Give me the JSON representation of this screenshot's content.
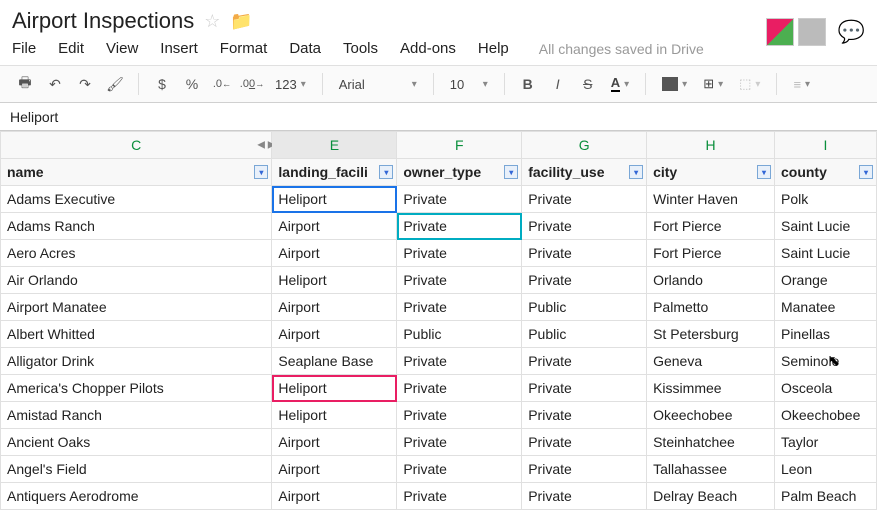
{
  "doc_title": "Airport Inspections",
  "menu": [
    "File",
    "Edit",
    "View",
    "Insert",
    "Format",
    "Data",
    "Tools",
    "Add-ons",
    "Help"
  ],
  "save_status": "All changes saved in Drive",
  "toolbar": {
    "currency": "$",
    "percent": "%",
    "dec_dec": ".0←",
    "dec_inc": ".00→",
    "num_format": "123",
    "font": "Arial",
    "font_size": "10"
  },
  "formula_bar": "Heliport",
  "columns": [
    {
      "letter": "C",
      "header": "name",
      "w": "w-name"
    },
    {
      "letter": "E",
      "header": "landing_facili",
      "w": "w-lf",
      "selected": true
    },
    {
      "letter": "F",
      "header": "owner_type",
      "w": "w-ot"
    },
    {
      "letter": "G",
      "header": "facility_use",
      "w": "w-fu"
    },
    {
      "letter": "H",
      "header": "city",
      "w": "w-city"
    },
    {
      "letter": "I",
      "header": "county",
      "w": "w-county"
    }
  ],
  "rows": [
    {
      "name": "Adams Executive",
      "lf": "Heliport",
      "ot": "Private",
      "fu": "Private",
      "city": "Winter Haven",
      "county": "Polk"
    },
    {
      "name": "Adams Ranch",
      "lf": "Airport",
      "ot": "Private",
      "fu": "Private",
      "city": "Fort Pierce",
      "county": "Saint Lucie"
    },
    {
      "name": "Aero Acres",
      "lf": "Airport",
      "ot": "Private",
      "fu": "Private",
      "city": "Fort Pierce",
      "county": "Saint Lucie"
    },
    {
      "name": "Air Orlando",
      "lf": "Heliport",
      "ot": "Private",
      "fu": "Private",
      "city": "Orlando",
      "county": "Orange"
    },
    {
      "name": "Airport Manatee",
      "lf": "Airport",
      "ot": "Private",
      "fu": "Public",
      "city": "Palmetto",
      "county": "Manatee"
    },
    {
      "name": "Albert Whitted",
      "lf": "Airport",
      "ot": "Public",
      "fu": "Public",
      "city": "St Petersburg",
      "county": "Pinellas"
    },
    {
      "name": "Alligator Drink",
      "lf": "Seaplane Base",
      "ot": "Private",
      "fu": "Private",
      "city": "Geneva",
      "county": "Seminole"
    },
    {
      "name": "America's Chopper Pilots",
      "lf": "Heliport",
      "ot": "Private",
      "fu": "Private",
      "city": "Kissimmee",
      "county": "Osceola"
    },
    {
      "name": "Amistad Ranch",
      "lf": "Heliport",
      "ot": "Private",
      "fu": "Private",
      "city": "Okeechobee",
      "county": "Okeechobee"
    },
    {
      "name": "Ancient Oaks",
      "lf": "Airport",
      "ot": "Private",
      "fu": "Private",
      "city": "Steinhatchee",
      "county": "Taylor"
    },
    {
      "name": "Angel's Field",
      "lf": "Airport",
      "ot": "Private",
      "fu": "Private",
      "city": "Tallahassee",
      "county": "Leon"
    },
    {
      "name": "Antiquers Aerodrome",
      "lf": "Airport",
      "ot": "Private",
      "fu": "Private",
      "city": "Delray Beach",
      "county": "Palm Beach"
    }
  ],
  "selections": {
    "blue": {
      "row": 0,
      "col": "lf"
    },
    "teal": {
      "row": 1,
      "col": "ot"
    },
    "pink": {
      "row": 7,
      "col": "lf"
    }
  },
  "cursor_at": {
    "row": 6,
    "col": "county"
  }
}
